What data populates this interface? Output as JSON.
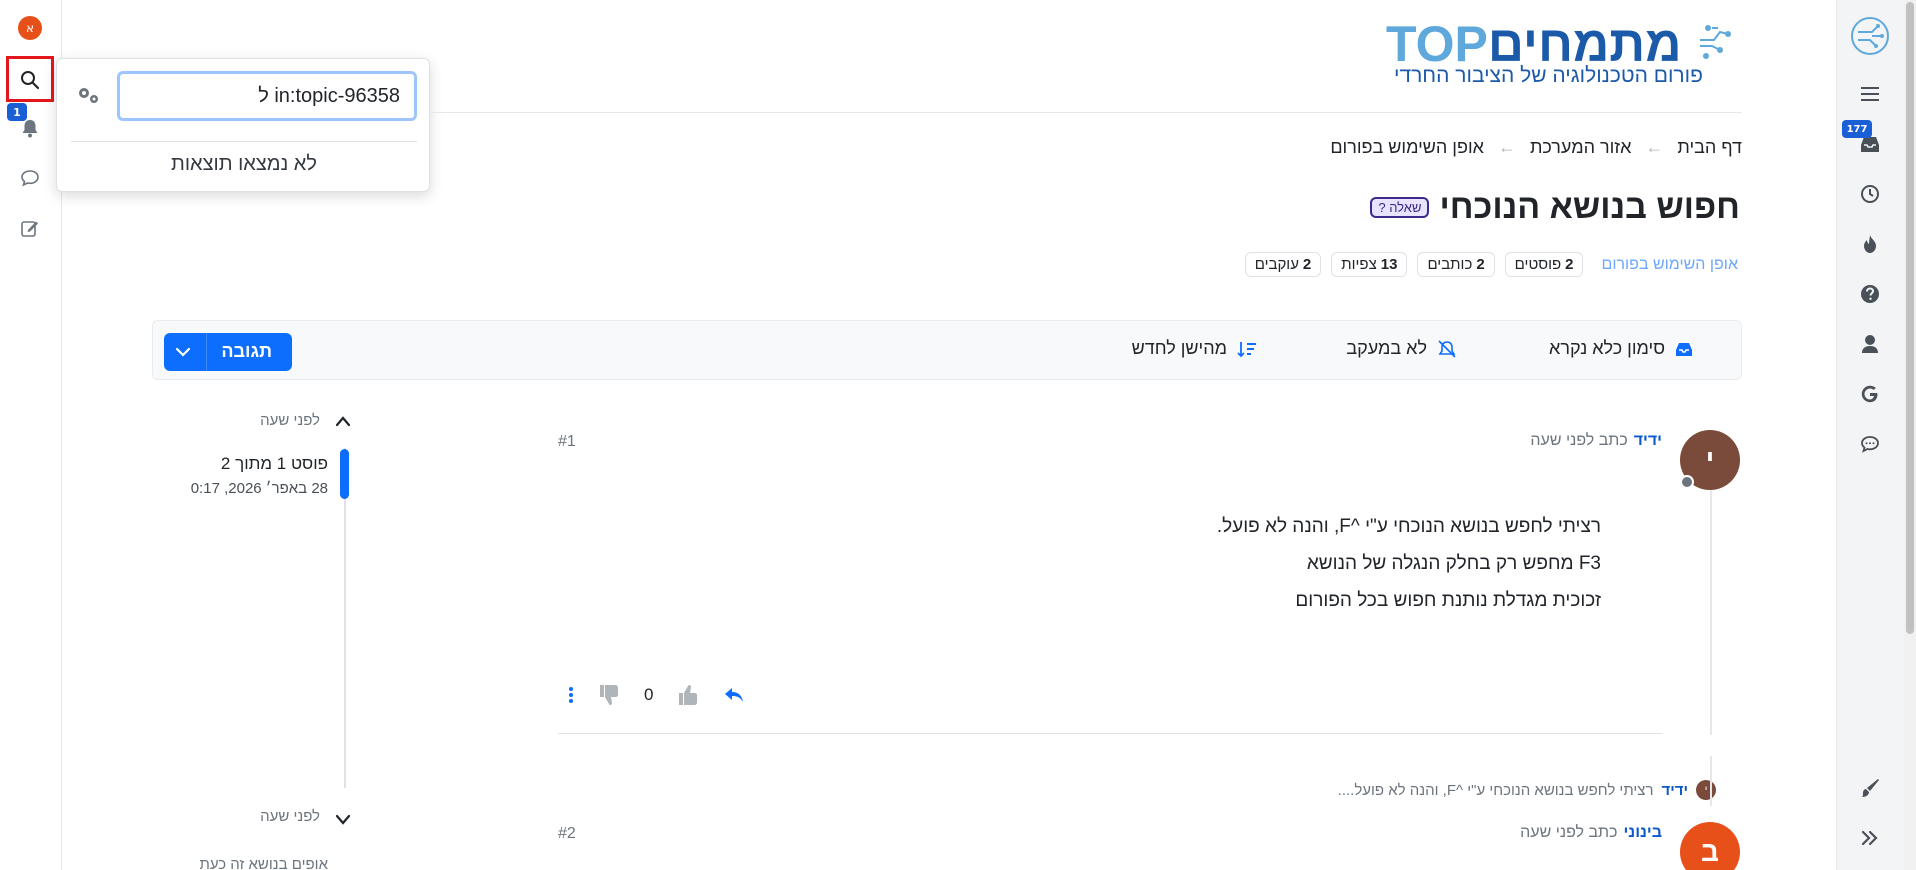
{
  "colors": {
    "primary": "#0d6efd",
    "badge": "#1a5fd6",
    "highlight": "#e3171b",
    "avatar_user": "#e8501a",
    "avatar_post1": "#7a4a3a",
    "avatar_post2": "#e8501a",
    "logo_dark": "#1b5aa8",
    "logo_light": "#5fa8dc",
    "question_tag": "#3d2a8b"
  },
  "left_sidebar": {
    "user_initial": "א",
    "notification_count": "1",
    "icons": [
      "search-icon",
      "bell-icon",
      "chat-icon",
      "compose-icon"
    ]
  },
  "right_sidebar": {
    "inbox_count": "177",
    "icons": [
      "logo-icon",
      "menu-icon",
      "inbox-icon",
      "clock-icon",
      "fire-icon",
      "question-icon",
      "user-icon",
      "google-icon",
      "comment-icon",
      "brush-icon",
      "chevrons-right-icon"
    ]
  },
  "search": {
    "query": "in:topic-96358 ל",
    "no_results": "לא נמצאו תוצאות"
  },
  "logo": {
    "main_hebrew": "מתמחים",
    "main_latin": "TOP",
    "tagline": "פורום הטכנולוגיה של הציבור החרדי"
  },
  "breadcrumb": {
    "items": [
      "דף הבית",
      "אזור המערכת",
      "אופן השימוש בפורום"
    ],
    "separator": "←"
  },
  "topic": {
    "title": "חפוש בנושא הנוכחי",
    "tag": "שאלה ?",
    "category": "אופן השימוש בפורום",
    "stats": [
      {
        "value": "2",
        "label": "פוסטים"
      },
      {
        "value": "2",
        "label": "כותבים"
      },
      {
        "value": "13",
        "label": "צפיות"
      },
      {
        "value": "2",
        "label": "עוקבים"
      }
    ]
  },
  "toolbar": {
    "mark_unread": "סימון כלא נקרא",
    "not_watching": "לא במעקב",
    "sort": "מהישן לחדש",
    "reply": "תגובה"
  },
  "timeline": {
    "top_time": "לפני שעה",
    "position": "פוסט 1 מתוך 2",
    "date": "28 באפר׳ 2026, 0:17",
    "bottom_time": "לפני שעה",
    "next_text": "אופים בנושא זה כעת"
  },
  "posts": [
    {
      "avatar_letter": "י",
      "author": "ידיד",
      "meta": "כתב לפני שעה",
      "index": "#1",
      "lines": [
        "רציתי לחפש בנושא הנוכחי ע\"י ^F, והנה לא פועל.",
        "F3 מחפש רק בחלק הנגלה של הנושא",
        "זכוכית מגדלת נותנת חפוש בכל הפורום"
      ],
      "votes": "0"
    },
    {
      "avatar_letter": "ב",
      "author": "בינוני",
      "meta": "כתב לפני שעה",
      "index": "#2"
    }
  ],
  "reply_preview": {
    "avatar_letter": "י",
    "author": "ידיד",
    "text": "רציתי לחפש בנושא הנוכחי ע\"י ^F, והנה לא פועל...."
  }
}
